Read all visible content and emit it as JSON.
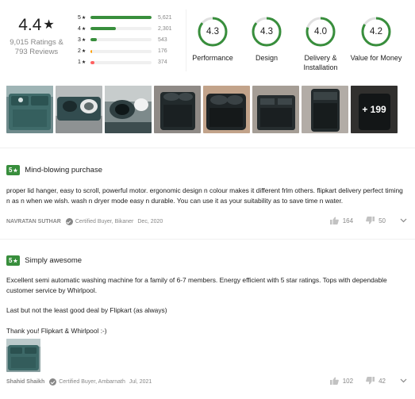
{
  "summary": {
    "overall_rating": "4.4",
    "star_glyph": "★",
    "ratings_count": "9,015 Ratings &",
    "reviews_count": "793 Reviews",
    "distribution": [
      {
        "stars": "5",
        "count": "5,621",
        "share": 1.0,
        "color": "#388e3c"
      },
      {
        "stars": "4",
        "count": "2,301",
        "share": 0.41,
        "color": "#388e3c"
      },
      {
        "stars": "3",
        "count": "543",
        "share": 0.1,
        "color": "#388e3c"
      },
      {
        "stars": "2",
        "count": "176",
        "share": 0.03,
        "color": "#ff9f00"
      },
      {
        "stars": "1",
        "count": "374",
        "share": 0.07,
        "color": "#ff6161"
      }
    ],
    "aspects": [
      {
        "value": "4.3",
        "name": "Performance",
        "score": 4.3
      },
      {
        "value": "4.3",
        "name": "Design",
        "score": 4.3
      },
      {
        "value": "4.0",
        "name": "Delivery & Installation",
        "score": 4.0
      },
      {
        "value": "4.2",
        "name": "Value for Money",
        "score": 4.2
      }
    ]
  },
  "gallery": {
    "more_label": "+ 199"
  },
  "reviews": [
    {
      "rating": "5",
      "title": "Mind-blowing purchase",
      "paragraphs": [
        "proper lid hanger, easy to scroll, powerful motor. ergonomic design n colour makes it different frlm others. flipkart delivery perfect timing n as n when we wish. wash n dryer mode easy n durable. You can use it as your suitability as to save time n water."
      ],
      "author": "NAVRATAN SUTHAR",
      "certified": "Certified Buyer, Bikaner",
      "date": "Dec, 2020",
      "likes": "164",
      "dislikes": "50"
    },
    {
      "rating": "5",
      "title": "Simply awesome",
      "paragraphs": [
        "Excellent semi automatic washing machine for a family of 6-7 members. Energy efficient with 5 star ratings. Tops with dependable customer service by Whirlpool.",
        "Last but not the least good deal by Flipkart (as always)",
        "Thank you! Flipkart & Whirlpool :-)"
      ],
      "author": "Shahid Shaikh",
      "certified": "Certified Buyer, Ambarnath",
      "date": "Jul, 2021",
      "likes": "102",
      "dislikes": "42"
    }
  ],
  "colors": {
    "accent_green": "#388e3c",
    "muted_text": "#878787",
    "divider": "#f0f0f0"
  }
}
